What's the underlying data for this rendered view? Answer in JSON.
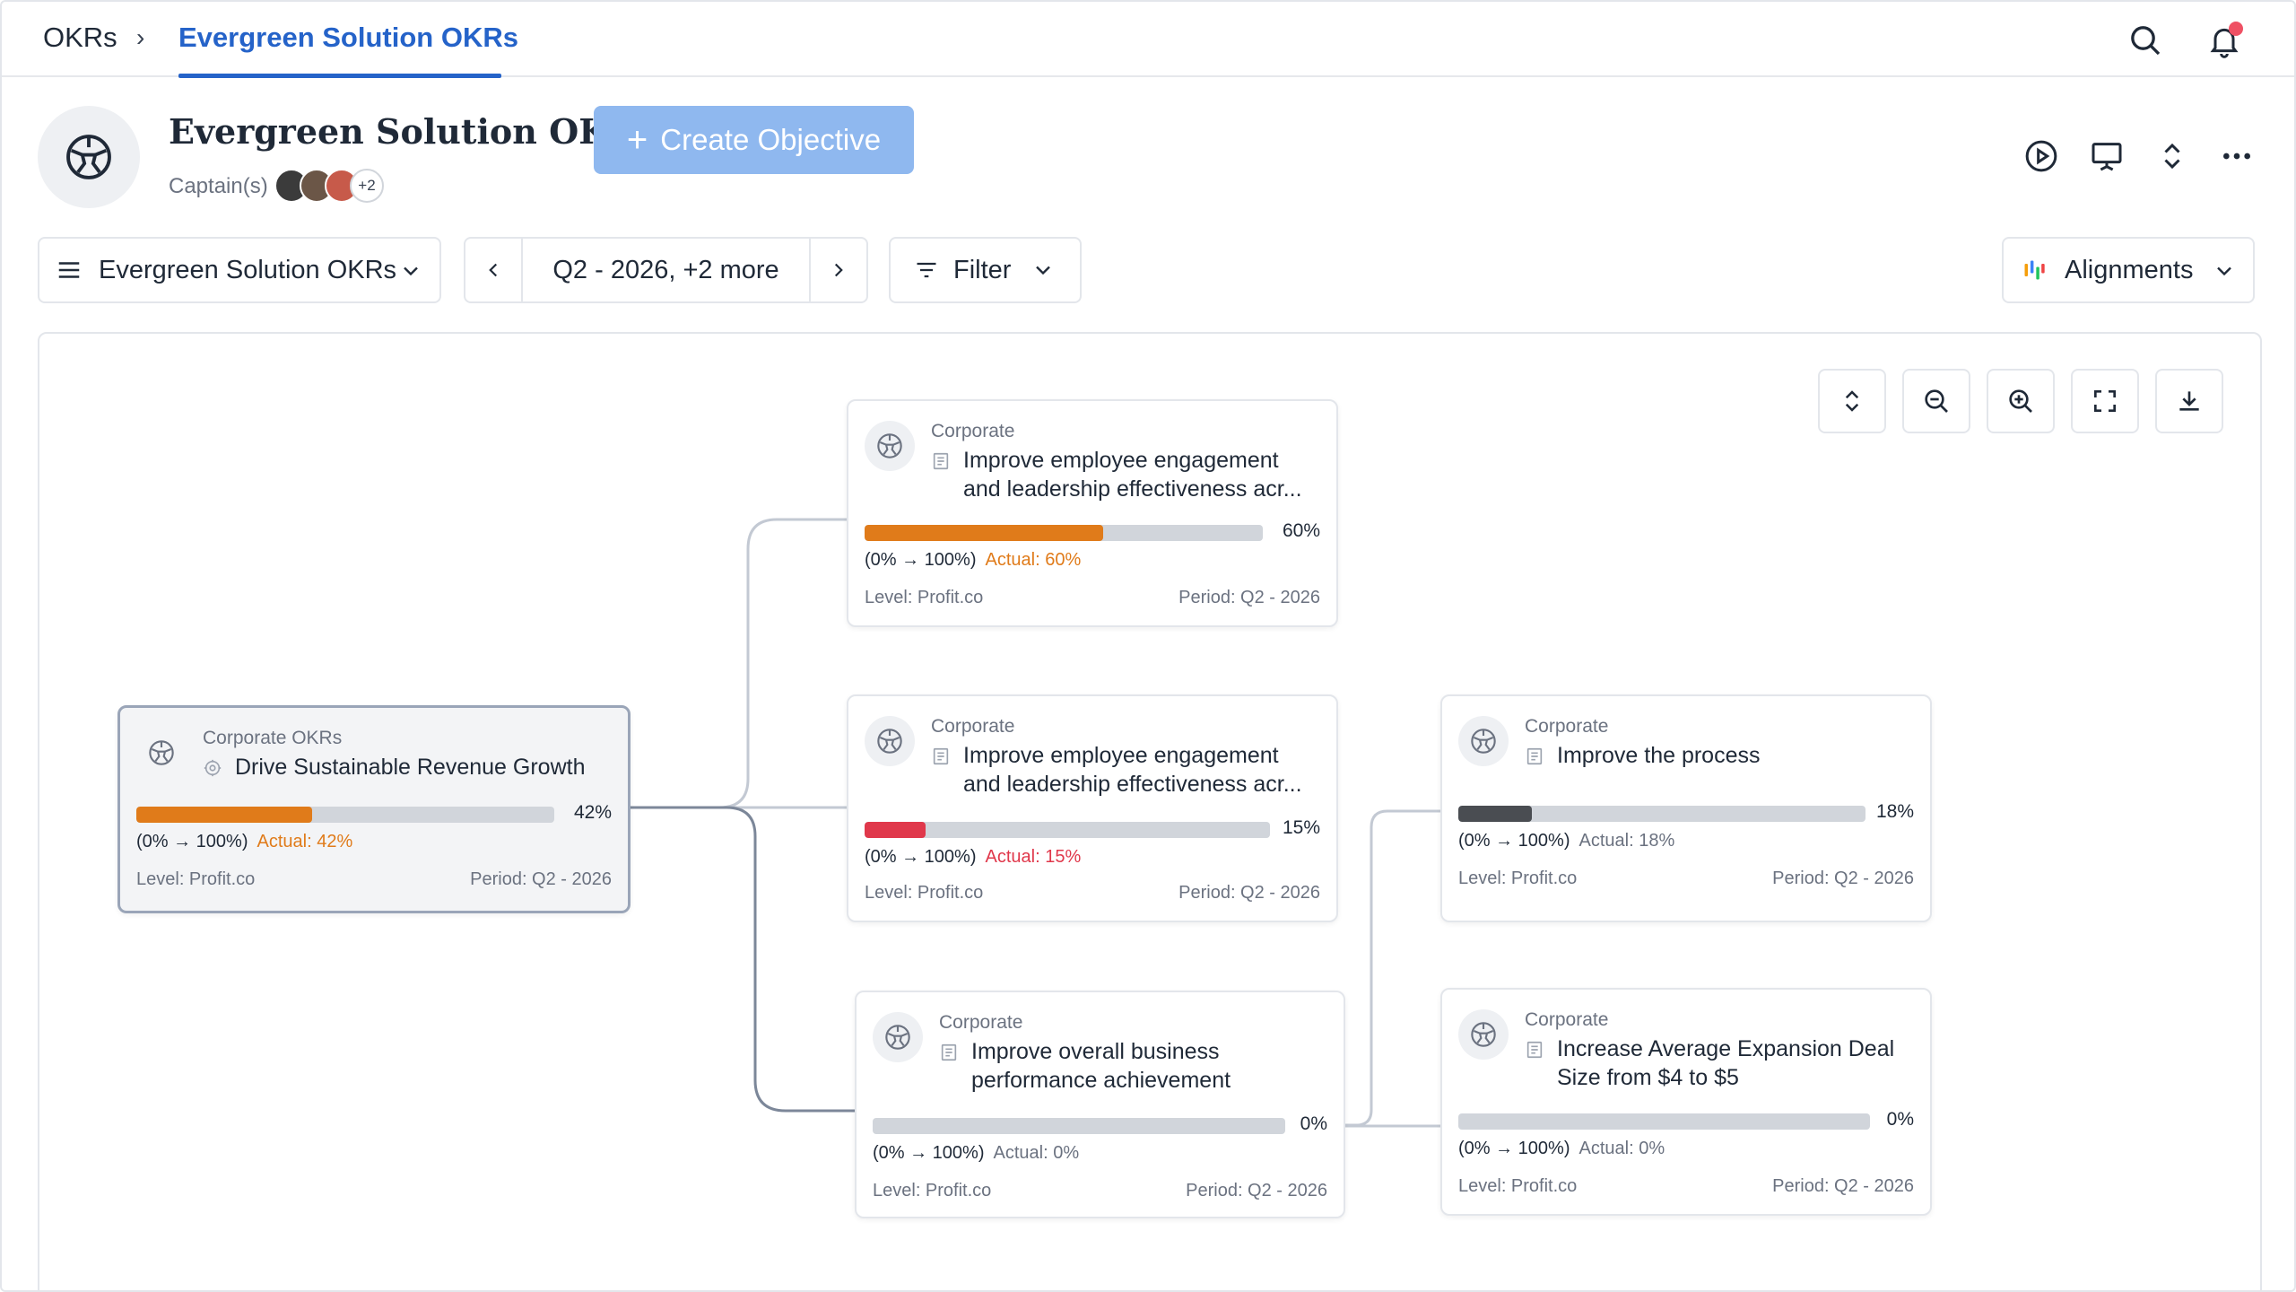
{
  "breadcrumb": {
    "root": "OKRs",
    "separator": "›",
    "current": "Evergreen Solution OKRs"
  },
  "header": {
    "title": "Evergreen Solution OKRs",
    "captain_label": "Captain(s)",
    "more_captains": "+2",
    "create_label": "Create Objective"
  },
  "toolbar": {
    "okr_selector": "Evergreen Solution OKRs",
    "period": "Q2 - 2026, +2 more",
    "filter": "Filter",
    "alignments": "Alignments"
  },
  "colors": {
    "accent": "#2563c9",
    "orange": "#e07b1a",
    "red": "#e0384b",
    "dark": "#4a4d52",
    "track": "#d1d5db"
  },
  "cards": [
    {
      "id": "root",
      "level_tag": "Corporate OKRs",
      "title": "Drive Sustainable Revenue Growth",
      "progress": 42,
      "pct": "42%",
      "range": "(0% → 100%)",
      "actual": "Actual: 42%",
      "level": "Level: Profit.co",
      "period": "Period: Q2 - 2026",
      "color": "#e07b1a"
    },
    {
      "id": "c1",
      "level_tag": "Corporate",
      "title": "Improve employee engagement and leadership effectiveness acr...",
      "progress": 60,
      "pct": "60%",
      "range": "(0% → 100%)",
      "actual": "Actual: 60%",
      "level": "Level: Profit.co",
      "period": "Period: Q2 - 2026",
      "color": "#e07b1a"
    },
    {
      "id": "c2",
      "level_tag": "Corporate",
      "title": "Improve employee engagement and leadership effectiveness acr...",
      "progress": 15,
      "pct": "15%",
      "range": "(0% → 100%)",
      "actual": "Actual: 15%",
      "level": "Level: Profit.co",
      "period": "Period: Q2 - 2026",
      "color": "#e0384b"
    },
    {
      "id": "c3",
      "level_tag": "Corporate",
      "title": "Improve overall business performance achievement",
      "progress": 0,
      "pct": "0%",
      "range": "(0% → 100%)",
      "actual": "Actual: 0%",
      "level": "Level: Profit.co",
      "period": "Period: Q2 - 2026",
      "color": "#4a4d52"
    },
    {
      "id": "c4",
      "level_tag": "Corporate",
      "title": "Improve the process",
      "progress": 18,
      "pct": "18%",
      "range": "(0% → 100%)",
      "actual": "Actual: 18%",
      "level": "Level: Profit.co",
      "period": "Period: Q2 - 2026",
      "color": "#4a4d52"
    },
    {
      "id": "c5",
      "level_tag": "Corporate",
      "title": "Increase Average Expansion Deal Size from $4 to $5",
      "progress": 0,
      "pct": "0%",
      "range": "(0% → 100%)",
      "actual": "Actual: 0%",
      "level": "Level: Profit.co",
      "period": "Period: Q2 - 2026",
      "color": "#4a4d52"
    }
  ]
}
